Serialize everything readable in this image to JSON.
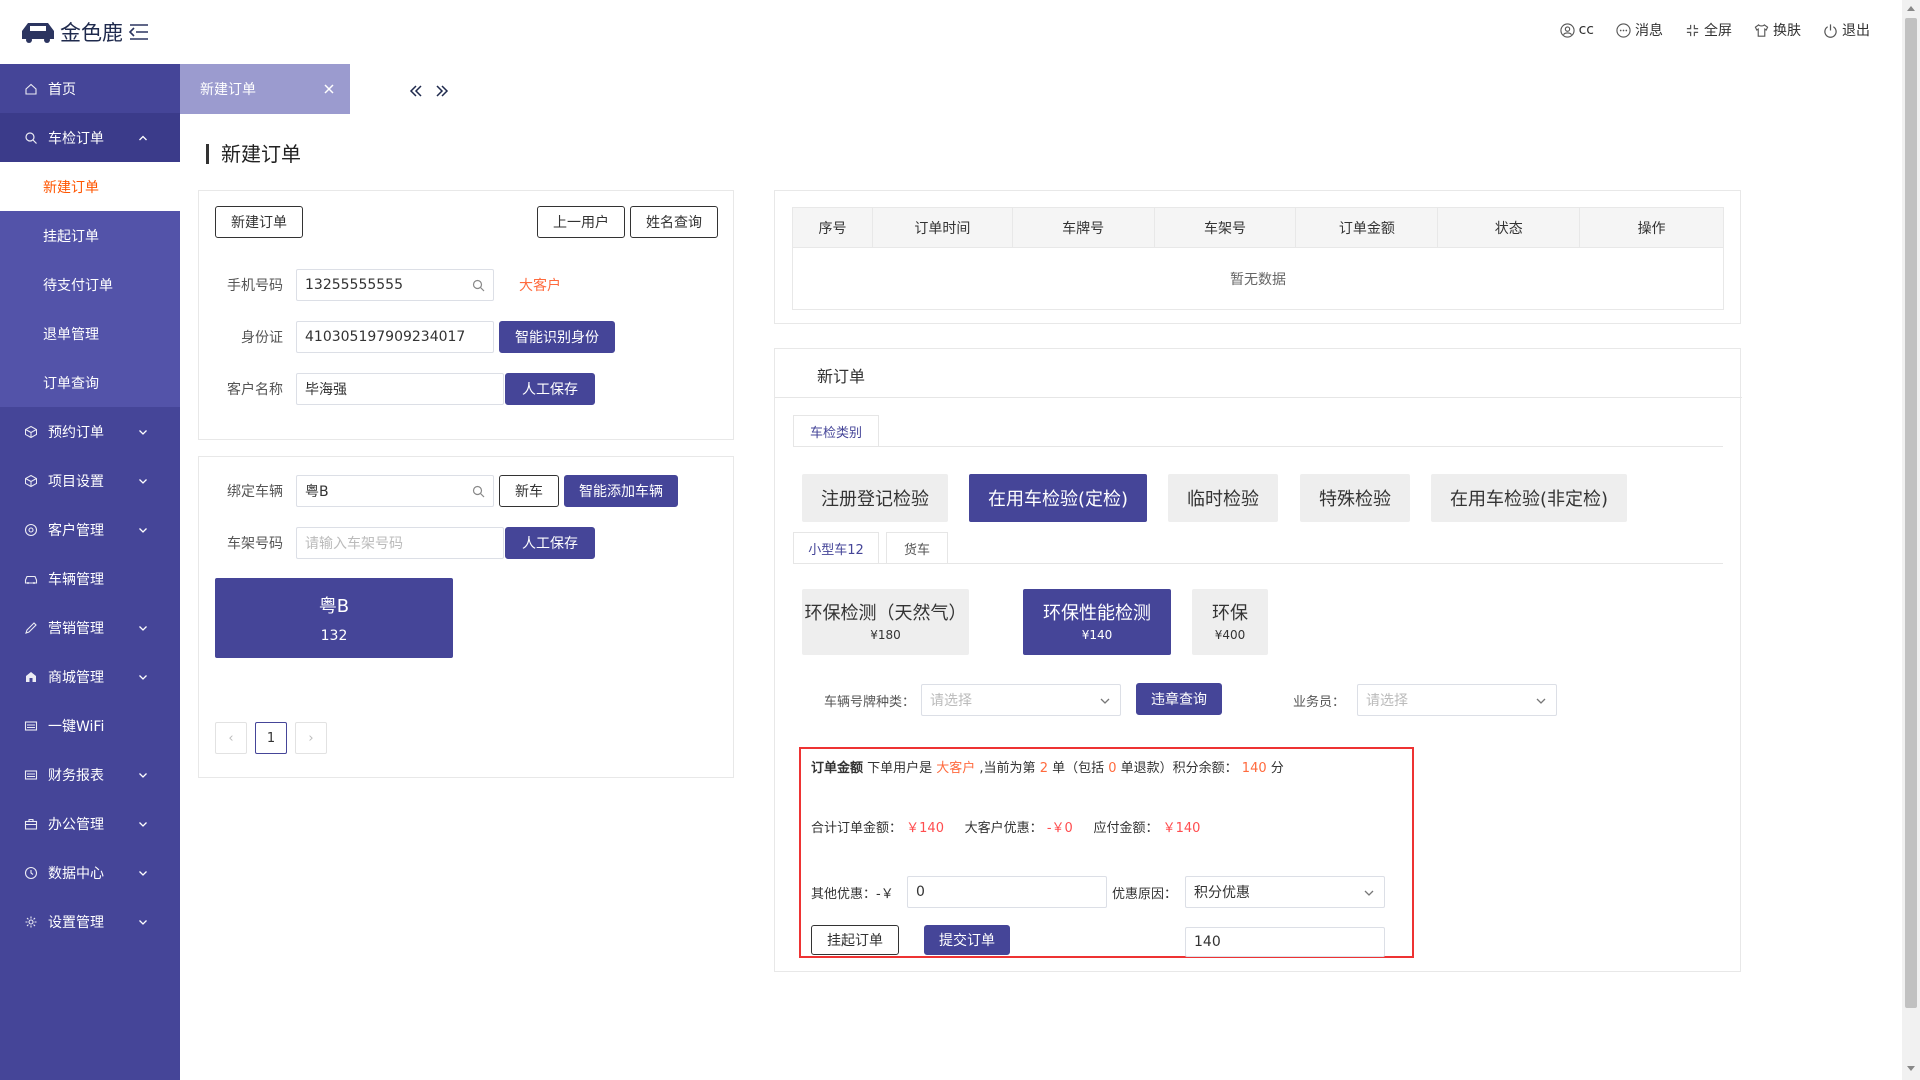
{
  "header": {
    "brand": "金色鹿",
    "user": "cc",
    "messages": "消息",
    "fullscreen": "全屏",
    "skin": "换肤",
    "logout": "退出"
  },
  "sidebar": {
    "items": [
      {
        "label": "首页"
      },
      {
        "label": "车检订单"
      },
      {
        "label": "预约订单"
      },
      {
        "label": "项目设置"
      },
      {
        "label": "客户管理"
      },
      {
        "label": "车辆管理"
      },
      {
        "label": "营销管理"
      },
      {
        "label": "商城管理"
      },
      {
        "label": "一键WiFi"
      },
      {
        "label": "财务报表"
      },
      {
        "label": "办公管理"
      },
      {
        "label": "数据中心"
      },
      {
        "label": "设置管理"
      }
    ],
    "sub_items": [
      {
        "label": "新建订单"
      },
      {
        "label": "挂起订单"
      },
      {
        "label": "待支付订单"
      },
      {
        "label": "退单管理"
      },
      {
        "label": "订单查询"
      }
    ]
  },
  "tabs": {
    "active": "新建订单"
  },
  "page": {
    "title": "新建订单"
  },
  "customer": {
    "new_order_button": "新建订单",
    "prev_user_button": "上一用户",
    "name_query_button": "姓名查询",
    "phone_label": "手机号码",
    "phone_value": "13255555555",
    "customer_tag": "大客户",
    "id_label": "身份证",
    "id_value": "410305197909234017",
    "id_recognize_button": "智能识别身份",
    "name_label": "客户名称",
    "name_value": "毕海强",
    "save_button": "人工保存"
  },
  "vehicle": {
    "bind_label": "绑定车辆",
    "bind_value": "粤B",
    "new_car_button": "新车",
    "smart_add_button": "智能添加车辆",
    "vin_label": "车架号码",
    "vin_placeholder": "请输入车架号码",
    "save_button": "人工保存",
    "card_plate": "粤B",
    "card_count": "132",
    "page_number": "1",
    "prev_glyph": "‹",
    "next_glyph": "›"
  },
  "orders_table": {
    "columns": [
      "序号",
      "订单时间",
      "车牌号",
      "车架号",
      "订单金额",
      "状态",
      "操作"
    ],
    "empty_text": "暂无数据"
  },
  "new_order": {
    "title": "新订单",
    "category_tab": "车检类别",
    "inspection_types": [
      {
        "label": "注册登记检验"
      },
      {
        "label": "在用车检验(定检)"
      },
      {
        "label": "临时检验"
      },
      {
        "label": "特殊检验"
      },
      {
        "label": "在用车检验(非定检)"
      }
    ],
    "vehicle_tabs": [
      {
        "label": "小型车12"
      },
      {
        "label": "货车"
      }
    ],
    "services": [
      {
        "name": "环保检测（天然气）",
        "price": "¥180"
      },
      {
        "name": "环保性能检测",
        "price": "¥140"
      },
      {
        "name": "环保",
        "price": "¥400"
      }
    ],
    "plate_type_label": "车辆号牌种类：",
    "plate_type_placeholder": "请选择",
    "violation_button": "违章查询",
    "salesman_label": "业务员：",
    "salesman_placeholder": "请选择"
  },
  "summary": {
    "head_bold": "订单金额",
    "head_text1": " 下单用户是 ",
    "head_tag": "大客户",
    "head_text2": " ,当前为第 ",
    "order_index": "2",
    "head_text3": " 单（包括 ",
    "refund_count": "0",
    "head_text4": " 单退款）积分余额： ",
    "points": "140",
    "head_text5": " 分",
    "total_label": "合计订单金额：",
    "total_value": "￥140",
    "discount_label": "大客户优惠：",
    "discount_value": "-￥0",
    "payable_label": "应付金额：",
    "payable_value": "￥140",
    "other_label": "其他优惠：-￥",
    "other_value": "0",
    "reason_label": "优惠原因：",
    "reason_value": "积分优惠",
    "hold_button": "挂起订单",
    "submit_button": "提交订单",
    "final_value": "140"
  }
}
